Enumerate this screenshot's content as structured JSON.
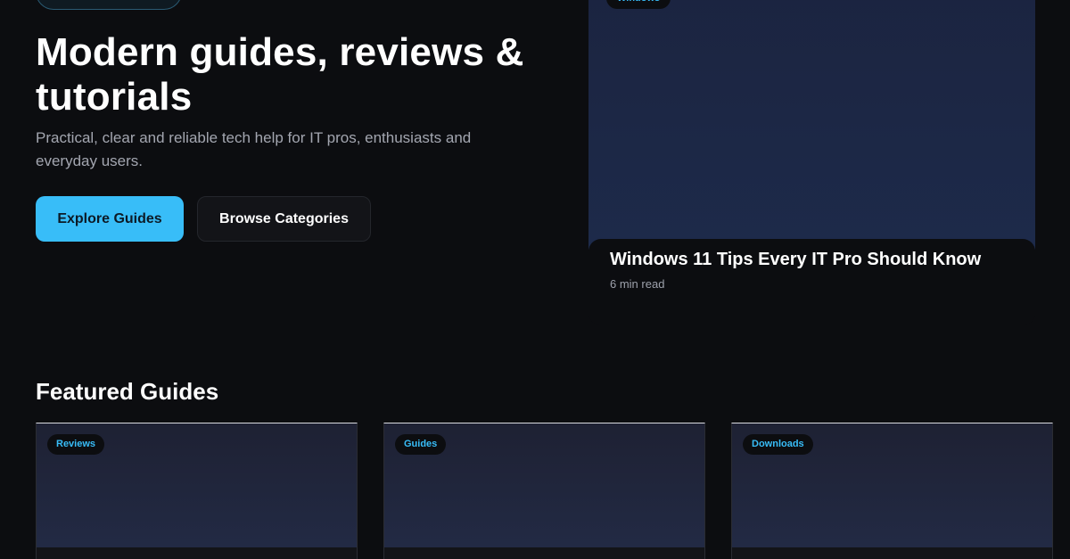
{
  "hero": {
    "title": "Modern guides, reviews & tutorials",
    "subtitle": "Practical, clear and reliable tech help for IT pros, enthusiasts and everyday users.",
    "primary_button": "Explore Guides",
    "secondary_button": "Browse Categories"
  },
  "featured_card": {
    "tag": "Windows",
    "title": "Windows 11 Tips Every IT Pro Should Know",
    "meta": "6 min read"
  },
  "featured_section": {
    "title": "Featured Guides",
    "cards": [
      {
        "tag": "Reviews"
      },
      {
        "tag": "Guides"
      },
      {
        "tag": "Downloads"
      }
    ]
  },
  "colors": {
    "background": "#0c0d10",
    "accent": "#38bdf8",
    "muted_text": "#a3a6b0"
  }
}
